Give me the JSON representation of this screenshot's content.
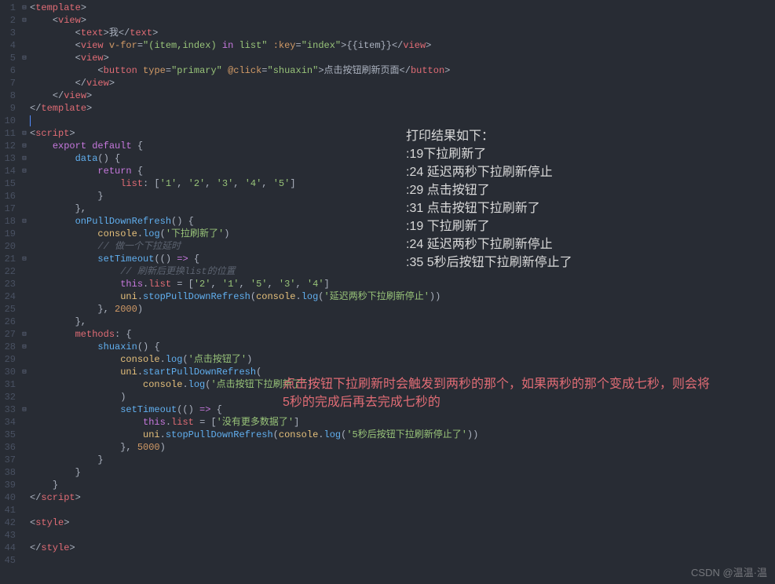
{
  "editor": {
    "lines": [
      {
        "n": 1,
        "fold": "⊟",
        "html": "<span class='bracket'>&lt;</span><span class='tag'>template</span><span class='bracket'>&gt;</span>"
      },
      {
        "n": 2,
        "fold": "⊟",
        "html": "    <span class='bracket'>&lt;</span><span class='tag'>view</span><span class='bracket'>&gt;</span>"
      },
      {
        "n": 3,
        "fold": "",
        "html": "        <span class='bracket'>&lt;</span><span class='tag'>text</span><span class='bracket'>&gt;</span><span class='plain'>我</span><span class='bracket'>&lt;/</span><span class='tag'>text</span><span class='bracket'>&gt;</span>"
      },
      {
        "n": 4,
        "fold": "",
        "html": "        <span class='bracket'>&lt;</span><span class='tag'>view</span> <span class='attr'>v-for</span><span class='bracket'>=</span><span class='attr-val'>\"(item,index) </span><span class='keyword'>in</span><span class='attr-val'> list\"</span> <span class='attr'>:key</span><span class='bracket'>=</span><span class='attr-val'>\"index\"</span><span class='bracket'>&gt;</span><span class='plain'>{{item}}</span><span class='bracket'>&lt;/</span><span class='tag'>view</span><span class='bracket'>&gt;</span>"
      },
      {
        "n": 5,
        "fold": "⊟",
        "html": "        <span class='bracket'>&lt;</span><span class='tag'>view</span><span class='bracket'>&gt;</span>"
      },
      {
        "n": 6,
        "fold": "",
        "html": "            <span class='bracket'>&lt;</span><span class='tag'>button</span> <span class='attr'>type</span><span class='bracket'>=</span><span class='attr-val'>\"primary\"</span> <span class='attr'>@click</span><span class='bracket'>=</span><span class='attr-val'>\"shuaxin\"</span><span class='bracket'>&gt;</span><span class='plain'>点击按钮刷新页面</span><span class='bracket'>&lt;/</span><span class='tag'>button</span><span class='bracket'>&gt;</span>"
      },
      {
        "n": 7,
        "fold": "",
        "html": "        <span class='bracket'>&lt;/</span><span class='tag'>view</span><span class='bracket'>&gt;</span>"
      },
      {
        "n": 8,
        "fold": "",
        "html": "    <span class='bracket'>&lt;/</span><span class='tag'>view</span><span class='bracket'>&gt;</span>"
      },
      {
        "n": 9,
        "fold": "",
        "html": "<span class='bracket'>&lt;/</span><span class='tag'>template</span><span class='bracket'>&gt;</span>"
      },
      {
        "n": 10,
        "fold": "",
        "html": "<span class='cursor'></span>"
      },
      {
        "n": 11,
        "fold": "⊟",
        "html": "<span class='bracket'>&lt;</span><span class='tag'>script</span><span class='bracket'>&gt;</span>"
      },
      {
        "n": 12,
        "fold": "⊟",
        "html": "    <span class='keyword'>export</span> <span class='keyword'>default</span> <span class='bracket'>{</span>"
      },
      {
        "n": 13,
        "fold": "⊟",
        "html": "        <span class='func'>data</span><span class='bracket'>() {</span>"
      },
      {
        "n": 14,
        "fold": "⊟",
        "html": "            <span class='keyword'>return</span> <span class='bracket'>{</span>"
      },
      {
        "n": 15,
        "fold": "",
        "html": "                <span class='prop'>list</span><span class='bracket'>: [</span><span class='str'>'1'</span><span class='bracket'>, </span><span class='str'>'2'</span><span class='bracket'>, </span><span class='str'>'3'</span><span class='bracket'>, </span><span class='str'>'4'</span><span class='bracket'>, </span><span class='str'>'5'</span><span class='bracket'>]</span>"
      },
      {
        "n": 16,
        "fold": "",
        "html": "            <span class='bracket'>}</span>"
      },
      {
        "n": 17,
        "fold": "",
        "html": "        <span class='bracket'>},</span>"
      },
      {
        "n": 18,
        "fold": "⊟",
        "html": "        <span class='func'>onPullDownRefresh</span><span class='bracket'>() {</span>"
      },
      {
        "n": 19,
        "fold": "",
        "html": "            <span class='var'>console</span><span class='bracket'>.</span><span class='func'>log</span><span class='bracket'>(</span><span class='str'>'下拉刷新了'</span><span class='bracket'>)</span>"
      },
      {
        "n": 20,
        "fold": "",
        "html": "            <span class='comment'>// 做一个下拉延时</span>"
      },
      {
        "n": 21,
        "fold": "⊟",
        "html": "            <span class='func'>setTimeout</span><span class='bracket'>(() </span><span class='keyword'>=&gt;</span><span class='bracket'> {</span>"
      },
      {
        "n": 22,
        "fold": "",
        "html": "                <span class='comment'>// 刷新后更换list的位置</span>"
      },
      {
        "n": 23,
        "fold": "",
        "html": "                <span class='keyword'>this</span><span class='bracket'>.</span><span class='prop'>list</span> <span class='bracket'>= [</span><span class='str'>'2'</span><span class='bracket'>, </span><span class='str'>'1'</span><span class='bracket'>, </span><span class='str'>'5'</span><span class='bracket'>, </span><span class='str'>'3'</span><span class='bracket'>, </span><span class='str'>'4'</span><span class='bracket'>]</span>"
      },
      {
        "n": 24,
        "fold": "",
        "html": "                <span class='var'>uni</span><span class='bracket'>.</span><span class='func'>stopPullDownRefresh</span><span class='bracket'>(</span><span class='var'>console</span><span class='bracket'>.</span><span class='func'>log</span><span class='bracket'>(</span><span class='str'>'延迟两秒下拉刷新停止'</span><span class='bracket'>))</span>"
      },
      {
        "n": 25,
        "fold": "",
        "html": "            <span class='bracket'>}, </span><span class='num'>2000</span><span class='bracket'>)</span>"
      },
      {
        "n": 26,
        "fold": "",
        "html": "        <span class='bracket'>},</span>"
      },
      {
        "n": 27,
        "fold": "⊟",
        "html": "        <span class='prop'>methods</span><span class='bracket'>: {</span>"
      },
      {
        "n": 28,
        "fold": "⊟",
        "html": "            <span class='func'>shuaxin</span><span class='bracket'>() {</span>"
      },
      {
        "n": 29,
        "fold": "",
        "html": "                <span class='var'>console</span><span class='bracket'>.</span><span class='func'>log</span><span class='bracket'>(</span><span class='str'>'点击按钮了'</span><span class='bracket'>)</span>"
      },
      {
        "n": 30,
        "fold": "⊟",
        "html": "                <span class='var'>uni</span><span class='bracket'>.</span><span class='func'>startPullDownRefresh</span><span class='bracket'>(</span>"
      },
      {
        "n": 31,
        "fold": "",
        "html": "                    <span class='var'>console</span><span class='bracket'>.</span><span class='func'>log</span><span class='bracket'>(</span><span class='str'>'点击按钮下拉刷新了'</span><span class='bracket'>)</span>"
      },
      {
        "n": 32,
        "fold": "",
        "html": "                <span class='bracket'>)</span>"
      },
      {
        "n": 33,
        "fold": "⊟",
        "html": "                <span class='func'>setTimeout</span><span class='bracket'>(() </span><span class='keyword'>=&gt;</span><span class='bracket'> {</span>"
      },
      {
        "n": 34,
        "fold": "",
        "html": "                    <span class='keyword'>this</span><span class='bracket'>.</span><span class='prop'>list</span> <span class='bracket'>= [</span><span class='str'>'没有更多数据了'</span><span class='bracket'>]</span>"
      },
      {
        "n": 35,
        "fold": "",
        "html": "                    <span class='var'>uni</span><span class='bracket'>.</span><span class='func'>stopPullDownRefresh</span><span class='bracket'>(</span><span class='var'>console</span><span class='bracket'>.</span><span class='func'>log</span><span class='bracket'>(</span><span class='str'>'5秒后按钮下拉刷新停止了'</span><span class='bracket'>))</span>"
      },
      {
        "n": 36,
        "fold": "",
        "html": "                <span class='bracket'>}, </span><span class='num'>5000</span><span class='bracket'>)</span>"
      },
      {
        "n": 37,
        "fold": "",
        "html": "            <span class='bracket'>}</span>"
      },
      {
        "n": 38,
        "fold": "",
        "html": "        <span class='bracket'>}</span>"
      },
      {
        "n": 39,
        "fold": "",
        "html": "    <span class='bracket'>}</span>"
      },
      {
        "n": 40,
        "fold": "",
        "html": "<span class='bracket'>&lt;/</span><span class='tag'>script</span><span class='bracket'>&gt;</span>"
      },
      {
        "n": 41,
        "fold": "",
        "html": ""
      },
      {
        "n": 42,
        "fold": "",
        "html": "<span class='bracket'>&lt;</span><span class='tag'>style</span><span class='bracket'>&gt;</span>"
      },
      {
        "n": 43,
        "fold": "",
        "html": ""
      },
      {
        "n": 44,
        "fold": "",
        "html": "<span class='bracket'>&lt;/</span><span class='tag'>style</span><span class='bracket'>&gt;</span>"
      },
      {
        "n": 45,
        "fold": "",
        "html": ""
      }
    ]
  },
  "output": {
    "title": "打印结果如下：",
    "lines": [
      ":19下拉刷新了",
      ":24 延迟两秒下拉刷新停止",
      ":29 点击按钮了",
      ":31 点击按钮下拉刷新了",
      ":19 下拉刷新了",
      ":24 延迟两秒下拉刷新停止",
      ":35 5秒后按钮下拉刷新停止了"
    ]
  },
  "annotation": {
    "line1": "点击按钮下拉刷新时会触发到两秒的那个，如果两秒的那个变成七秒，则会将",
    "line2": "5秒的完成后再去完成七秒的"
  },
  "watermark": "CSDN @温温·温"
}
